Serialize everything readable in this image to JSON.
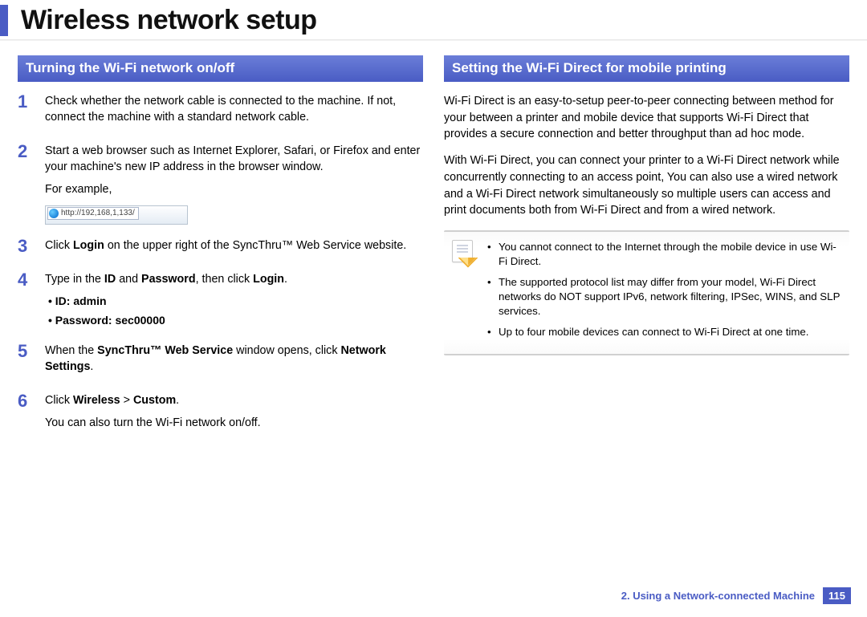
{
  "header": {
    "title": "Wireless network setup"
  },
  "left": {
    "section_title": "Turning the Wi-Fi network on/off",
    "steps": {
      "s1": {
        "num": "1",
        "text": "Check whether the network cable is connected to the machine. If not, connect the machine with a standard network cable."
      },
      "s2": {
        "num": "2",
        "text": "Start a web browser such as Internet Explorer, Safari, or Firefox and enter your machine's new IP address in the browser window.",
        "example_label": "For example,",
        "url": "http://192,168,1,133/"
      },
      "s3": {
        "num": "3",
        "pre": "Click ",
        "b1": "Login",
        "post": " on the upper right of the SyncThru™ Web Service website."
      },
      "s4": {
        "num": "4",
        "pre": "Type in the ",
        "b1": "ID",
        "mid1": " and ",
        "b2": "Password",
        "mid2": ", then click ",
        "b3": "Login",
        "post": ".",
        "bullets": {
          "id": "ID: admin",
          "pw": "Password: sec00000"
        }
      },
      "s5": {
        "num": "5",
        "pre": "When the ",
        "b1": "SyncThru™ Web Service",
        "mid1": " window opens, click ",
        "b2": "Network Settings",
        "post": "."
      },
      "s6": {
        "num": "6",
        "pre": "Click ",
        "b1": "Wireless",
        "mid1": " > ",
        "b2": "Custom",
        "post": ".",
        "extra": "You can also turn the Wi-Fi network on/off."
      }
    }
  },
  "right": {
    "section_title": "Setting the Wi-Fi Direct for mobile printing",
    "para1": "Wi-Fi Direct is an easy-to-setup peer-to-peer connecting between method for your between a printer and mobile device that supports Wi-Fi Direct that provides a secure connection and better throughput than ad hoc mode.",
    "para2": "With Wi-Fi Direct, you can connect your printer to a Wi-Fi Direct network while concurrently connecting to an access point, You can also use a wired network and a Wi-Fi Direct network simultaneously so multiple users can access and print documents both from Wi-Fi Direct and from a wired network.",
    "notes": {
      "n1": "You cannot connect to the Internet through the mobile device in use Wi-Fi Direct.",
      "n2": "The supported protocol list may differ from your model, Wi-Fi Direct networks do NOT support IPv6, network filtering, IPSec, WINS, and SLP services.",
      "n3": "Up to four mobile devices can connect to Wi-Fi Direct at one time."
    }
  },
  "footer": {
    "chapter": "2.  Using a Network-connected Machine",
    "page": "115"
  }
}
